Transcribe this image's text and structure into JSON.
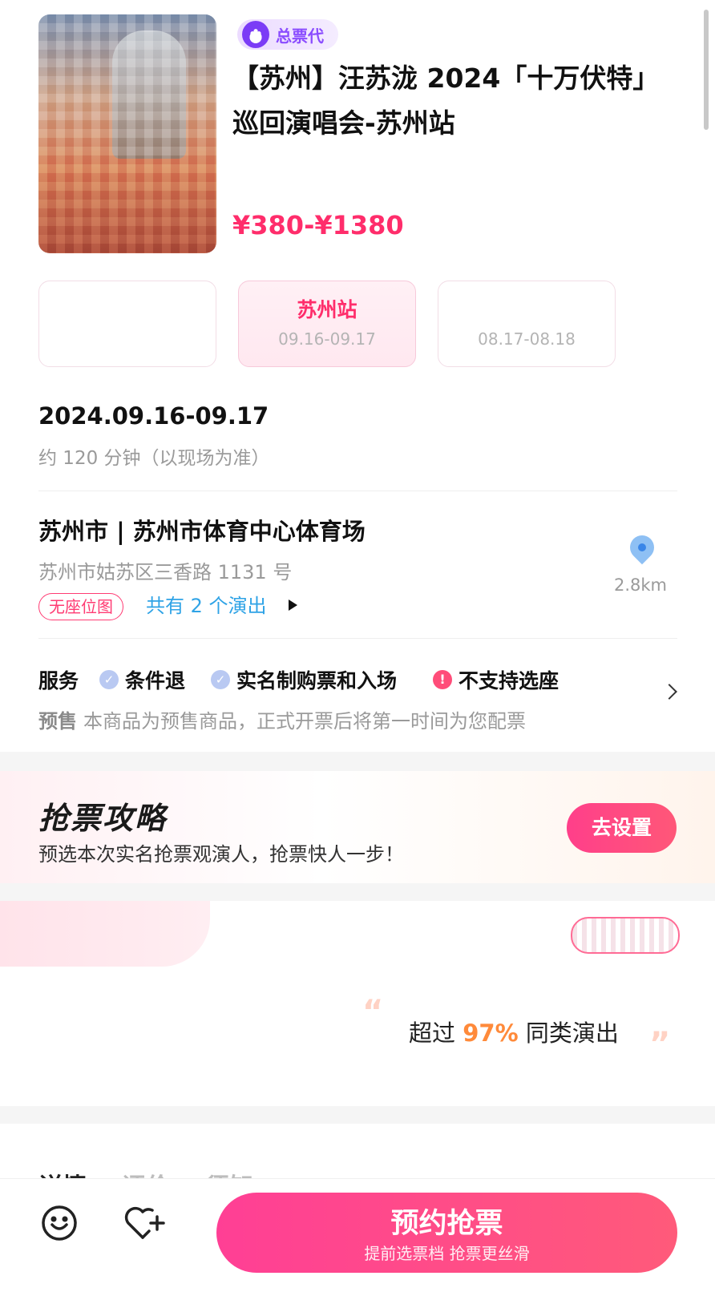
{
  "header": {
    "badge": "总票代",
    "title": "【苏州】汪苏泷 2024「十万伏特」巡回演唱会-苏州站",
    "price": "¥380-¥1380"
  },
  "sessions": [
    {
      "title": "",
      "date": ""
    },
    {
      "title": "苏州站",
      "date": "09.16-09.17"
    },
    {
      "title": "",
      "date": "08.17-08.18"
    }
  ],
  "event": {
    "date": "2024.09.16-09.17",
    "duration": "约 120 分钟（以现场为准）"
  },
  "venue": {
    "name": "苏州市 | 苏州市体育中心体育场",
    "address": "苏州市姑苏区三香路 1131 号",
    "tag": "无座位图",
    "show_count": "共有 2 个演出",
    "distance": "2.8km"
  },
  "service": {
    "label": "服务",
    "items": [
      "条件退",
      "实名制购票和入场",
      "不支持选座"
    ],
    "presale_label": "预售",
    "presale_text": "本商品为预售商品，正式开票后将第一时间为您配票"
  },
  "strategy": {
    "title": "抢票攻略",
    "subtitle": "预选本次实名抢票观演人，抢票快人一步！",
    "button": "去设置"
  },
  "ranking": {
    "prefix": "超过",
    "percent": "97%",
    "suffix": "同类演出"
  },
  "tabs": [
    "详情",
    "评价",
    "须知"
  ],
  "bottom": {
    "cta_main": "预约抢票",
    "cta_sub": "提前选票档 抢票更丝滑"
  },
  "colors": {
    "accent": "#ff2d6b",
    "badge": "#8a4cff",
    "link": "#2fa3e6",
    "highlight": "#ff8a3a"
  }
}
